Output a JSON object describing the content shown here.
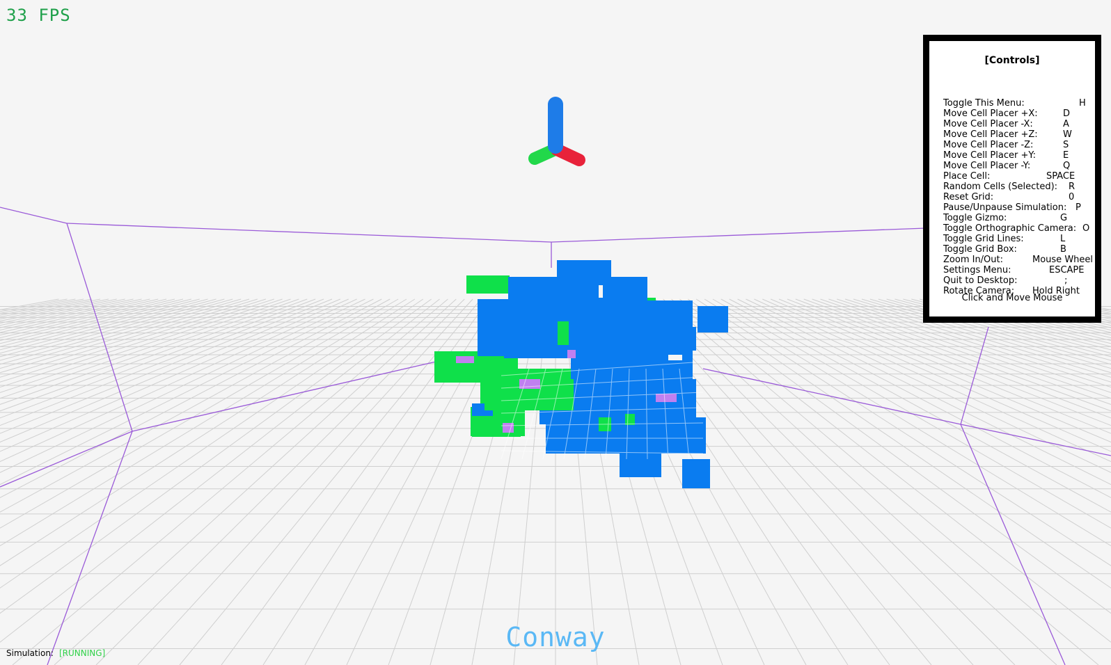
{
  "fps": "33 FPS",
  "controls": {
    "title": "[Controls]",
    "items": [
      {
        "action": "Toggle This Menu:",
        "key": "H"
      },
      {
        "action": "Move Cell Placer +X:",
        "key": "D"
      },
      {
        "action": "Move Cell Placer -X:",
        "key": "A"
      },
      {
        "action": "Move Cell Placer +Z:",
        "key": "W"
      },
      {
        "action": "Move Cell Placer -Z:",
        "key": "S"
      },
      {
        "action": "Move Cell Placer +Y:",
        "key": "E"
      },
      {
        "action": "Move Cell Placer -Y:",
        "key": "Q"
      },
      {
        "action": "Place Cell:",
        "key": "SPACE"
      },
      {
        "action": "Random Cells (Selected):",
        "key": "R"
      },
      {
        "action": "Reset Grid:",
        "key": "0"
      },
      {
        "action": "Pause/Unpause Simulation:",
        "key": "P"
      },
      {
        "action": "Toggle Gizmo:",
        "key": "G"
      },
      {
        "action": "Toggle Orthographic Camera:",
        "key": "O"
      },
      {
        "action": "Toggle Grid Lines:",
        "key": "L"
      },
      {
        "action": "Toggle Grid Box:",
        "key": "B"
      },
      {
        "action": "Zoom In/Out:",
        "key": "Mouse Wheel"
      },
      {
        "action": "Settings Menu:",
        "key": "ESCAPE"
      },
      {
        "action": "Quit to Desktop:",
        "key": ";"
      },
      {
        "action": "Rotate Camera:",
        "key": "Hold Right"
      }
    ],
    "footer": "Click and Move Mouse"
  },
  "simulation": {
    "label": "Simulation:",
    "status": "[RUNNING]"
  },
  "app_title": "Conway",
  "colors": {
    "cell_blue": "#0a7cf0",
    "cell_green": "#0fe04a",
    "cell_pink": "#c080f0",
    "grid_box": "#9a5ad8",
    "gizmo_x": "#e8223a",
    "gizmo_y": "#1e7ce8",
    "gizmo_z": "#22d84a"
  }
}
